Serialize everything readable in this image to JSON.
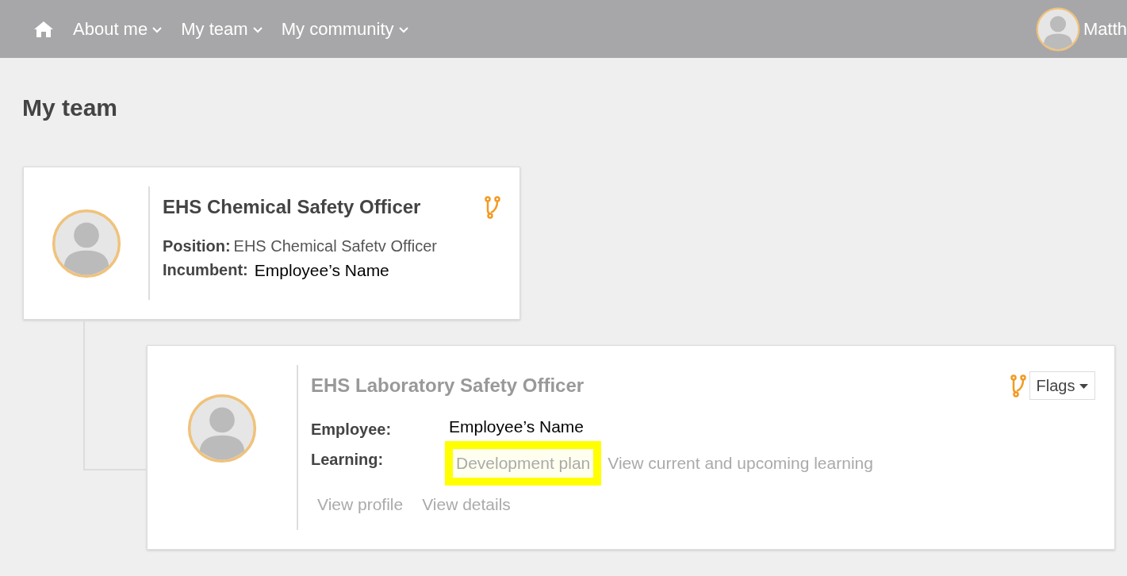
{
  "navbar": {
    "items": [
      {
        "label": "About me",
        "dropdown": true
      },
      {
        "label": "My team",
        "dropdown": true
      },
      {
        "label": "My community",
        "dropdown": true
      }
    ],
    "user": {
      "name": "Matth"
    }
  },
  "page_title": "My team",
  "manager_card": {
    "title": "EHS Chemical Safety Officer",
    "position_label": "Position:",
    "position_value": "EHS Chemical Safetv Officer",
    "incumbent_label": "Incumbent:",
    "incumbent_value": "Employee’s Name"
  },
  "report_card": {
    "title": "EHS Laboratory Safety Officer",
    "flags_button": "Flags",
    "employee_label": "Employee:",
    "employee_value": "Employee’s Name",
    "learning_label": "Learning:",
    "learning_links": [
      {
        "label": "Development plan",
        "highlighted": true
      },
      {
        "label": "View current and upcoming learning",
        "highlighted": false
      }
    ],
    "links": [
      {
        "label": "View profile"
      },
      {
        "label": "View details"
      }
    ]
  }
}
